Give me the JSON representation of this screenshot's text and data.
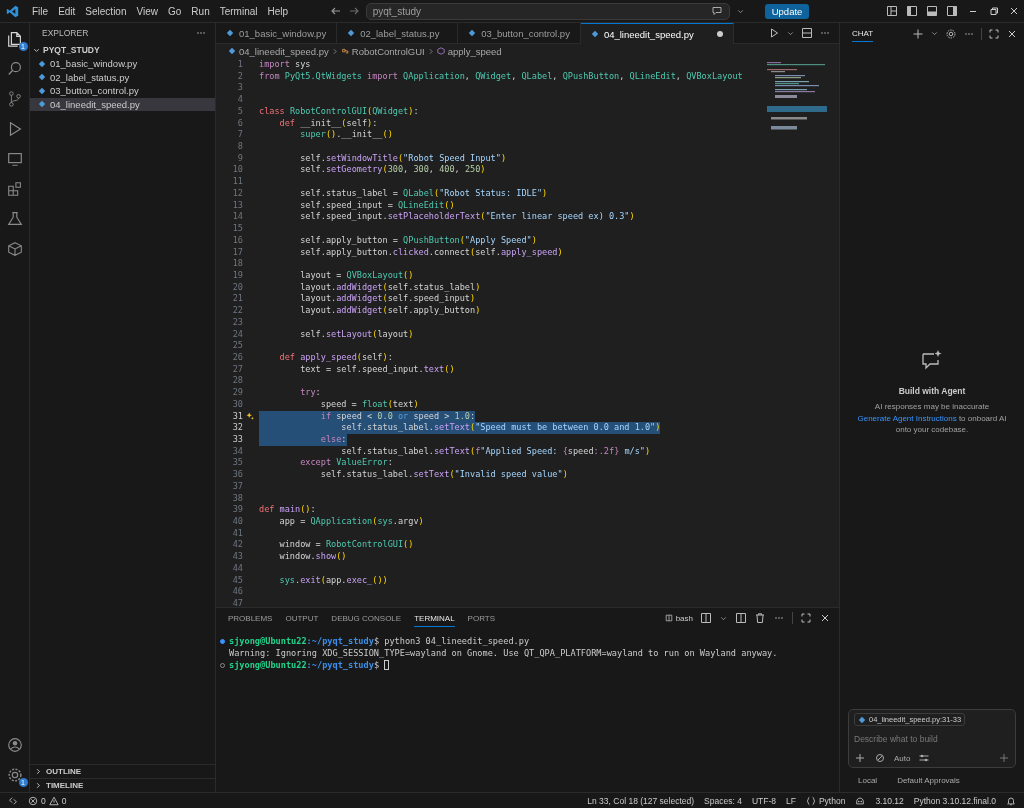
{
  "title_bar": {
    "menu": [
      "File",
      "Edit",
      "Selection",
      "View",
      "Go",
      "Run",
      "Terminal",
      "Help"
    ],
    "search": {
      "value": "pyqt_study"
    },
    "update_button": "Update"
  },
  "activity_bar": {
    "explorer_badge": "1",
    "settings_badge": "1"
  },
  "explorer": {
    "title": "EXPLORER",
    "folder": "PYQT_STUDY",
    "files": [
      {
        "name": "01_basic_window.py",
        "selected": false
      },
      {
        "name": "02_label_status.py",
        "selected": false
      },
      {
        "name": "03_button_control.py",
        "selected": false
      },
      {
        "name": "04_lineedit_speed.py",
        "selected": true
      }
    ],
    "sections": [
      "OUTLINE",
      "TIMELINE"
    ]
  },
  "editor": {
    "tabs": [
      {
        "label": "01_basic_window.py",
        "selected": false,
        "modified": false
      },
      {
        "label": "02_label_status.py",
        "selected": false,
        "modified": false
      },
      {
        "label": "03_button_control.py",
        "selected": false,
        "modified": false
      },
      {
        "label": "04_lineedit_speed.py",
        "selected": true,
        "modified": true
      }
    ],
    "breadcrumbs": [
      "04_lineedit_speed.py",
      "RobotControlGUI",
      "apply_speed"
    ],
    "lines": [
      {
        "number": "1",
        "selected": false,
        "tokens": [
          {
            "text": "import",
            "kind": "keyword"
          },
          {
            "text": " sys",
            "kind": "plain"
          }
        ]
      },
      {
        "number": "2",
        "selected": false,
        "tokens": [
          {
            "text": "from ",
            "kind": "keyword"
          },
          {
            "text": "PyQt5.QtWidgets",
            "kind": "type"
          },
          {
            "text": " import ",
            "kind": "keyword"
          },
          {
            "text": "QApplication",
            "kind": "type"
          },
          {
            "text": ", ",
            "kind": "plain"
          },
          {
            "text": "QWidget",
            "kind": "type"
          },
          {
            "text": ", ",
            "kind": "plain"
          },
          {
            "text": "QLabel",
            "kind": "type"
          },
          {
            "text": ", ",
            "kind": "plain"
          },
          {
            "text": "QPushButton",
            "kind": "type"
          },
          {
            "text": ", ",
            "kind": "plain"
          },
          {
            "text": "QLineEdit",
            "kind": "type"
          },
          {
            "text": ", ",
            "kind": "plain"
          },
          {
            "text": "QVBoxLayout",
            "kind": "type"
          }
        ]
      },
      {
        "number": "3",
        "selected": false
      },
      {
        "number": "4",
        "selected": false
      },
      {
        "number": "5",
        "selected": false,
        "tokens": [
          {
            "text": "class ",
            "kind": "declaration"
          },
          {
            "text": "RobotControlGUI",
            "kind": "type"
          },
          {
            "text": "(",
            "kind": "bracket"
          },
          {
            "text": "QWidget",
            "kind": "type"
          },
          {
            "text": ")",
            "kind": "bracket"
          },
          {
            "text": ":",
            "kind": "plain"
          }
        ]
      },
      {
        "number": "6",
        "selected": false,
        "tokens": [
          {
            "text": "    def",
            "kind": "declaration"
          },
          {
            "text": " __init__",
            "kind": "plain"
          },
          {
            "text": "(",
            "kind": "bracket"
          },
          {
            "text": "self",
            "kind": "plain"
          },
          {
            "text": ")",
            "kind": "bracket"
          },
          {
            "text": ":",
            "kind": "plain"
          }
        ]
      },
      {
        "number": "7",
        "selected": false,
        "tokens": [
          {
            "text": "        super",
            "kind": "type"
          },
          {
            "text": "()",
            "kind": "bracket"
          },
          {
            "text": ".__init__",
            "kind": "plain"
          },
          {
            "text": "()",
            "kind": "bracket"
          }
        ]
      },
      {
        "number": "8",
        "selected": false
      },
      {
        "number": "9",
        "selected": false,
        "tokens": [
          {
            "text": "        self.",
            "kind": "plain"
          },
          {
            "text": "setWindowTitle",
            "kind": "function"
          },
          {
            "text": "(",
            "kind": "bracket"
          },
          {
            "text": "\"Robot Speed Input\"",
            "kind": "string"
          },
          {
            "text": ")",
            "kind": "bracket"
          }
        ]
      },
      {
        "number": "10",
        "selected": false,
        "tokens": [
          {
            "text": "        self.",
            "kind": "plain"
          },
          {
            "text": "setGeometry",
            "kind": "function"
          },
          {
            "text": "(",
            "kind": "bracket"
          },
          {
            "text": "300",
            "kind": "number"
          },
          {
            "text": ", ",
            "kind": "plain"
          },
          {
            "text": "300",
            "kind": "number"
          },
          {
            "text": ", ",
            "kind": "plain"
          },
          {
            "text": "400",
            "kind": "number"
          },
          {
            "text": ", ",
            "kind": "plain"
          },
          {
            "text": "250",
            "kind": "number"
          },
          {
            "text": ")",
            "kind": "bracket"
          }
        ]
      },
      {
        "number": "11",
        "selected": false
      },
      {
        "number": "12",
        "selected": false,
        "tokens": [
          {
            "text": "        self.status_label = ",
            "kind": "plain"
          },
          {
            "text": "QLabel",
            "kind": "type"
          },
          {
            "text": "(",
            "kind": "bracket"
          },
          {
            "text": "\"Robot Status: IDLE\"",
            "kind": "string"
          },
          {
            "text": ")",
            "kind": "bracket"
          }
        ]
      },
      {
        "number": "13",
        "selected": false,
        "tokens": [
          {
            "text": "        self.speed_input = ",
            "kind": "plain"
          },
          {
            "text": "QLineEdit",
            "kind": "type"
          },
          {
            "text": "()",
            "kind": "bracket"
          }
        ]
      },
      {
        "number": "14",
        "selected": false,
        "tokens": [
          {
            "text": "        self.speed_input.",
            "kind": "plain"
          },
          {
            "text": "setPlaceholderText",
            "kind": "function"
          },
          {
            "text": "(",
            "kind": "bracket"
          },
          {
            "text": "\"Enter linear speed ex) 0.3\"",
            "kind": "string"
          },
          {
            "text": ")",
            "kind": "bracket"
          }
        ]
      },
      {
        "number": "15",
        "selected": false
      },
      {
        "number": "16",
        "selected": false,
        "tokens": [
          {
            "text": "        self.apply_button = ",
            "kind": "plain"
          },
          {
            "text": "QPushButton",
            "kind": "type"
          },
          {
            "text": "(",
            "kind": "bracket"
          },
          {
            "text": "\"Apply Speed\"",
            "kind": "string"
          },
          {
            "text": ")",
            "kind": "bracket"
          }
        ]
      },
      {
        "number": "17",
        "selected": false,
        "tokens": [
          {
            "text": "        self.apply_button.",
            "kind": "plain"
          },
          {
            "text": "clicked",
            "kind": "function"
          },
          {
            "text": ".connect",
            "kind": "plain"
          },
          {
            "text": "(",
            "kind": "bracket"
          },
          {
            "text": "self.",
            "kind": "plain"
          },
          {
            "text": "apply_speed",
            "kind": "function"
          },
          {
            "text": ")",
            "kind": "bracket"
          }
        ]
      },
      {
        "number": "18",
        "selected": false
      },
      {
        "number": "19",
        "selected": false,
        "tokens": [
          {
            "text": "        layout = ",
            "kind": "plain"
          },
          {
            "text": "QVBoxLayout",
            "kind": "type"
          },
          {
            "text": "()",
            "kind": "bracket"
          }
        ]
      },
      {
        "number": "20",
        "selected": false,
        "tokens": [
          {
            "text": "        layout.",
            "kind": "plain"
          },
          {
            "text": "addWidget",
            "kind": "function"
          },
          {
            "text": "(",
            "kind": "bracket"
          },
          {
            "text": "self.status_label",
            "kind": "plain"
          },
          {
            "text": ")",
            "kind": "bracket"
          }
        ]
      },
      {
        "number": "21",
        "selected": false,
        "tokens": [
          {
            "text": "        layout.",
            "kind": "plain"
          },
          {
            "text": "addWidget",
            "kind": "function"
          },
          {
            "text": "(",
            "kind": "bracket"
          },
          {
            "text": "self.speed_input",
            "kind": "plain"
          },
          {
            "text": ")",
            "kind": "bracket"
          }
        ]
      },
      {
        "number": "22",
        "selected": false,
        "tokens": [
          {
            "text": "        layout.",
            "kind": "plain"
          },
          {
            "text": "addWidget",
            "kind": "function"
          },
          {
            "text": "(",
            "kind": "bracket"
          },
          {
            "text": "self.apply_button",
            "kind": "plain"
          },
          {
            "text": ")",
            "kind": "bracket"
          }
        ]
      },
      {
        "number": "23",
        "selected": false
      },
      {
        "number": "24",
        "selected": false,
        "tokens": [
          {
            "text": "        self.",
            "kind": "plain"
          },
          {
            "text": "setLayout",
            "kind": "function"
          },
          {
            "text": "(",
            "kind": "bracket"
          },
          {
            "text": "layout",
            "kind": "plain"
          },
          {
            "text": ")",
            "kind": "bracket"
          }
        ]
      },
      {
        "number": "25",
        "selected": false
      },
      {
        "number": "26",
        "selected": false,
        "tokens": [
          {
            "text": "    def ",
            "kind": "declaration"
          },
          {
            "text": "apply_speed",
            "kind": "function"
          },
          {
            "text": "(",
            "kind": "bracket"
          },
          {
            "text": "self",
            "kind": "plain"
          },
          {
            "text": ")",
            "kind": "bracket"
          },
          {
            "text": ":",
            "kind": "plain"
          }
        ]
      },
      {
        "number": "27",
        "selected": false,
        "tokens": [
          {
            "text": "        text = self.speed_input.",
            "kind": "plain"
          },
          {
            "text": "text",
            "kind": "function"
          },
          {
            "text": "()",
            "kind": "bracket"
          }
        ]
      },
      {
        "number": "28",
        "selected": false
      },
      {
        "number": "29",
        "selected": false,
        "tokens": [
          {
            "text": "        try",
            "kind": "keyword"
          },
          {
            "text": ":",
            "kind": "plain"
          }
        ]
      },
      {
        "number": "30",
        "selected": false,
        "tokens": [
          {
            "text": "            speed = ",
            "kind": "plain"
          },
          {
            "text": "float",
            "kind": "type"
          },
          {
            "text": "(",
            "kind": "bracket"
          },
          {
            "text": "text",
            "kind": "plain"
          },
          {
            "text": ")",
            "kind": "bracket"
          }
        ]
      },
      {
        "number": "31",
        "selected": true,
        "ai_hint": true,
        "tokens": [
          {
            "text": "            if",
            "kind": "keyword"
          },
          {
            "text": " speed < ",
            "kind": "plain"
          },
          {
            "text": "0.0",
            "kind": "number"
          },
          {
            "text": " or",
            "kind": "operator"
          },
          {
            "text": " speed > ",
            "kind": "plain"
          },
          {
            "text": "1.0",
            "kind": "number"
          },
          {
            "text": ":",
            "kind": "plain"
          }
        ]
      },
      {
        "number": "32",
        "selected": true,
        "tokens": [
          {
            "text": "                self.status_label.",
            "kind": "plain"
          },
          {
            "text": "setText",
            "kind": "function"
          },
          {
            "text": "(",
            "kind": "bracket"
          },
          {
            "text": "\"Speed must be between 0.0 and 1.0\"",
            "kind": "string"
          },
          {
            "text": ")",
            "kind": "bracket"
          }
        ]
      },
      {
        "number": "33",
        "selected": true,
        "tokens": [
          {
            "text": "            else",
            "kind": "keyword"
          },
          {
            "text": ":",
            "kind": "plain"
          }
        ]
      },
      {
        "number": "34",
        "selected": false,
        "tokens": [
          {
            "text": "                self.status_label.",
            "kind": "plain"
          },
          {
            "text": "setText",
            "kind": "function"
          },
          {
            "text": "(",
            "kind": "bracket"
          },
          {
            "text": "f",
            "kind": "keyword"
          },
          {
            "text": "\"Applied Speed: ",
            "kind": "string"
          },
          {
            "text": "{",
            "kind": "keyword"
          },
          {
            "text": "speed",
            "kind": "plain"
          },
          {
            "text": ":.2f",
            "kind": "keyword"
          },
          {
            "text": "}",
            "kind": "keyword"
          },
          {
            "text": " m/s\"",
            "kind": "string"
          },
          {
            "text": ")",
            "kind": "bracket"
          }
        ]
      },
      {
        "number": "35",
        "selected": false,
        "tokens": [
          {
            "text": "        except ",
            "kind": "keyword"
          },
          {
            "text": "ValueError",
            "kind": "type"
          },
          {
            "text": ":",
            "kind": "plain"
          }
        ]
      },
      {
        "number": "36",
        "selected": false,
        "tokens": [
          {
            "text": "            self.status_label.",
            "kind": "plain"
          },
          {
            "text": "setText",
            "kind": "function"
          },
          {
            "text": "(",
            "kind": "bracket"
          },
          {
            "text": "\"Invalid speed value\"",
            "kind": "string"
          },
          {
            "text": ")",
            "kind": "bracket"
          }
        ]
      },
      {
        "number": "37",
        "selected": false
      },
      {
        "number": "38",
        "selected": false
      },
      {
        "number": "39",
        "selected": false,
        "tokens": [
          {
            "text": "def ",
            "kind": "declaration"
          },
          {
            "text": "main",
            "kind": "function"
          },
          {
            "text": "()",
            "kind": "bracket"
          },
          {
            "text": ":",
            "kind": "plain"
          }
        ]
      },
      {
        "number": "40",
        "selected": false,
        "tokens": [
          {
            "text": "    app = ",
            "kind": "plain"
          },
          {
            "text": "QApplication",
            "kind": "type"
          },
          {
            "text": "(",
            "kind": "bracket"
          },
          {
            "text": "sys",
            "kind": "type"
          },
          {
            "text": ".argv",
            "kind": "plain"
          },
          {
            "text": ")",
            "kind": "bracket"
          }
        ]
      },
      {
        "number": "41",
        "selected": false
      },
      {
        "number": "42",
        "selected": false,
        "tokens": [
          {
            "text": "    window = ",
            "kind": "plain"
          },
          {
            "text": "RobotControlGUI",
            "kind": "type"
          },
          {
            "text": "()",
            "kind": "bracket"
          }
        ]
      },
      {
        "number": "43",
        "selected": false,
        "tokens": [
          {
            "text": "    window.",
            "kind": "plain"
          },
          {
            "text": "show",
            "kind": "function"
          },
          {
            "text": "()",
            "kind": "bracket"
          }
        ]
      },
      {
        "number": "44",
        "selected": false
      },
      {
        "number": "45",
        "selected": false,
        "tokens": [
          {
            "text": "    sys",
            "kind": "type"
          },
          {
            "text": ".",
            "kind": "plain"
          },
          {
            "text": "exit",
            "kind": "function"
          },
          {
            "text": "(",
            "kind": "bracket"
          },
          {
            "text": "app.",
            "kind": "plain"
          },
          {
            "text": "exec_",
            "kind": "function"
          },
          {
            "text": "())",
            "kind": "bracket"
          }
        ]
      },
      {
        "number": "46",
        "selected": false
      },
      {
        "number": "47",
        "selected": false
      }
    ]
  },
  "panel": {
    "tabs": [
      {
        "label": "PROBLEMS",
        "selected": false
      },
      {
        "label": "OUTPUT",
        "selected": false
      },
      {
        "label": "DEBUG CONSOLE",
        "selected": false
      },
      {
        "label": "TERMINAL",
        "selected": true
      },
      {
        "label": "PORTS",
        "selected": false
      }
    ],
    "shell": "bash",
    "terminal": [
      {
        "kind": "prompt",
        "finished": true,
        "user": "sjyong@Ubuntu22",
        "path": ":~/pyqt_study",
        "command": "$ python3 04_lineedit_speed.py"
      },
      {
        "kind": "output",
        "text": "Warning: Ignoring XDG_SESSION_TYPE=wayland on Gnome. Use QT_QPA_PLATFORM=wayland to run on Wayland anyway."
      },
      {
        "kind": "prompt",
        "finished": false,
        "user": "sjyong@Ubuntu22",
        "path": ":~/pyqt_study",
        "command": "$"
      }
    ]
  },
  "chat": {
    "title": "CHAT",
    "heading": "Build with Agent",
    "note": "AI responses may be inaccurate",
    "link": "Generate Agent Instructions",
    "link_suffix": " to onboard AI onto your codebase.",
    "context": "04_lineedit_speed.py:31-33",
    "placeholder": "Describe what to build",
    "mode": "Auto",
    "target": "Local",
    "approvals": "Default Approvals"
  },
  "status_bar": {
    "errors": "0",
    "warnings": "0",
    "position": "Ln 33, Col 18 (127 selected)",
    "indent": "Spaces: 4",
    "encoding": "UTF-8",
    "eol": "LF",
    "language": "Python",
    "python_version": "3.10.12",
    "interpreter": "Python 3.10.12.final.0"
  }
}
